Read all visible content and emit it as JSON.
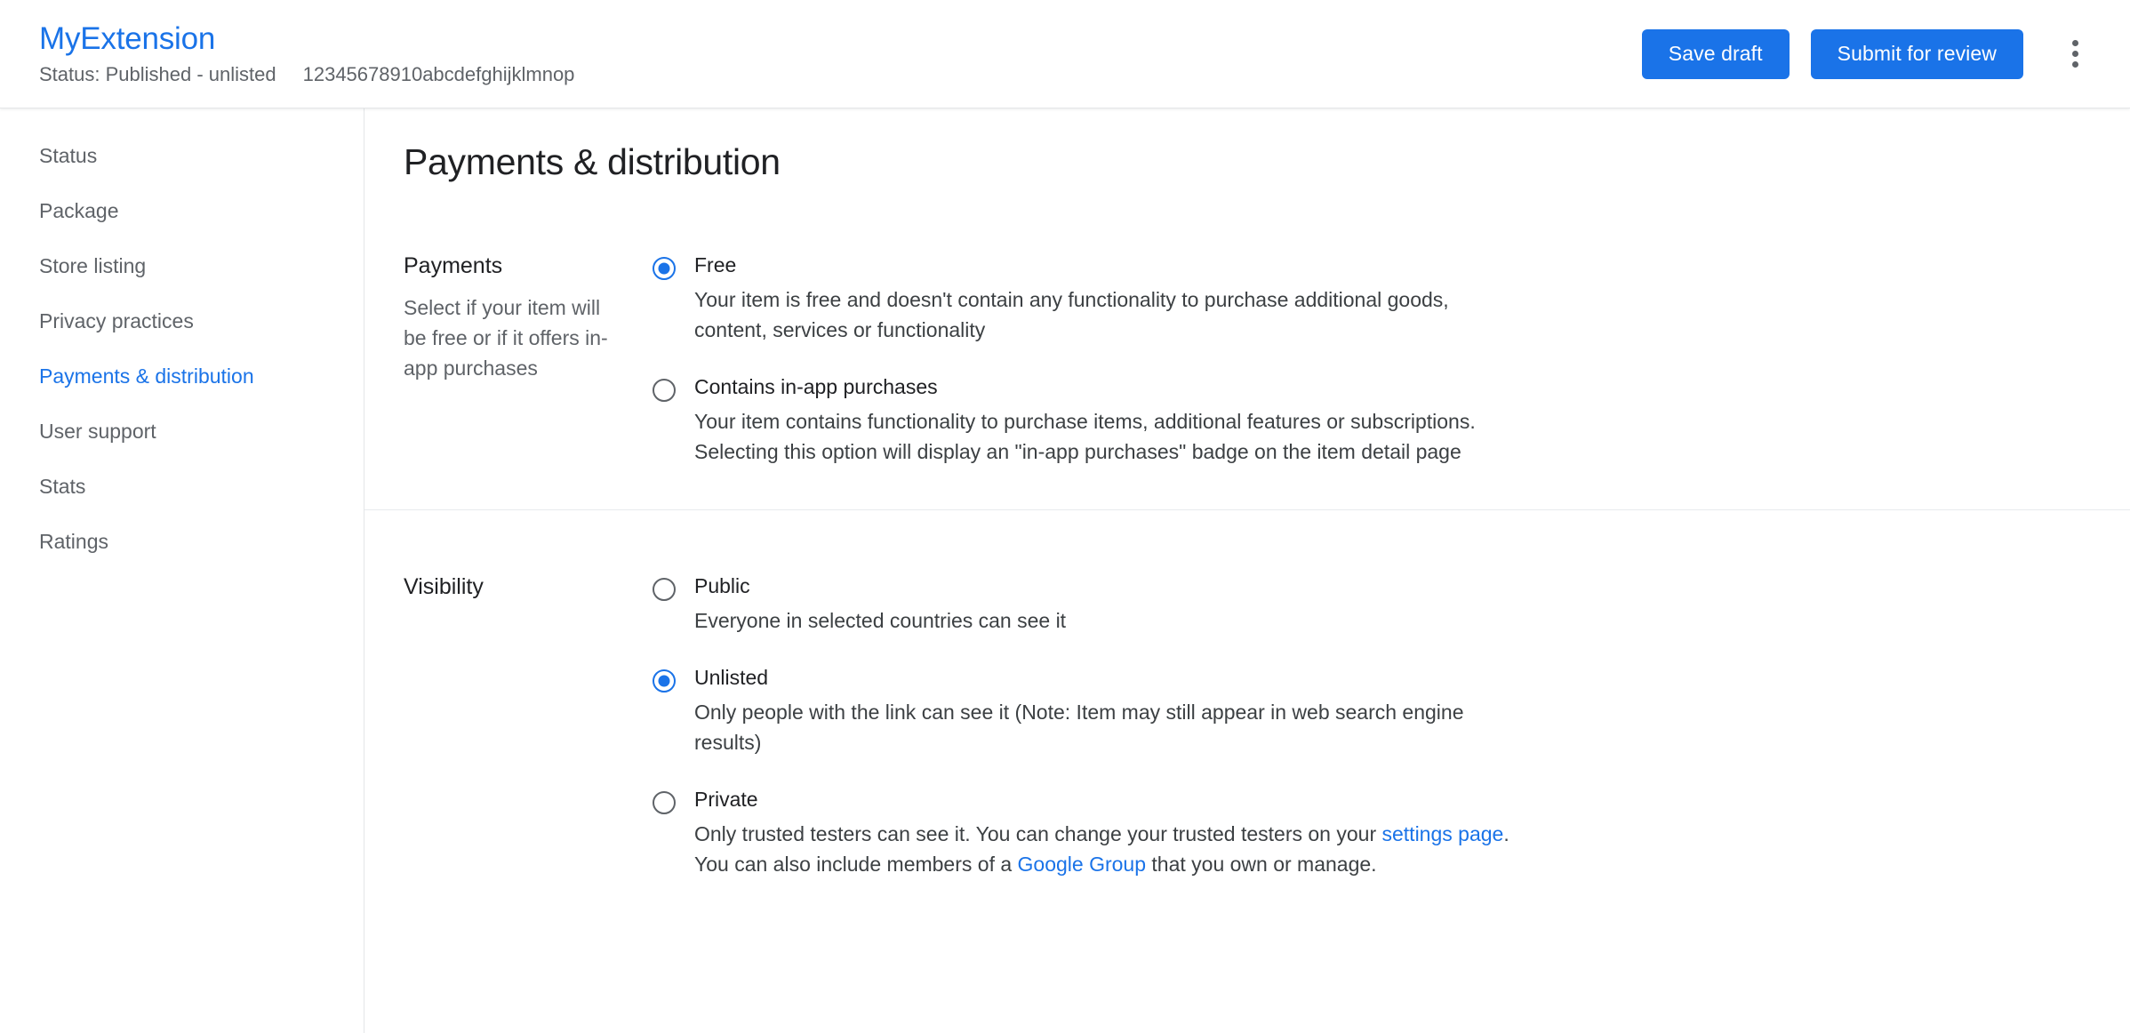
{
  "header": {
    "app_title": "MyExtension",
    "status": "Status: Published - unlisted",
    "item_id": "12345678910abcdefghijklmnop",
    "save_draft_label": "Save draft",
    "submit_label": "Submit for review",
    "overflow_icon": "more-vert-icon"
  },
  "sidebar": {
    "items": [
      {
        "label": "Status",
        "active": false
      },
      {
        "label": "Package",
        "active": false
      },
      {
        "label": "Store listing",
        "active": false
      },
      {
        "label": "Privacy practices",
        "active": false
      },
      {
        "label": "Payments & distribution",
        "active": true
      },
      {
        "label": "User support",
        "active": false
      },
      {
        "label": "Stats",
        "active": false
      },
      {
        "label": "Ratings",
        "active": false
      }
    ]
  },
  "main": {
    "page_title": "Payments & distribution",
    "payments": {
      "label": "Payments",
      "help": "Select if your item will be free or if it offers in-app purchases",
      "options": [
        {
          "label": "Free",
          "desc": "Your item is free and doesn't contain any functionality to purchase additional goods, content, services or functionality",
          "selected": true
        },
        {
          "label": "Contains in-app purchases",
          "desc": "Your item contains functionality to purchase items, additional features or subscriptions. Selecting this option will display an \"in-app purchases\" badge on the item detail page",
          "selected": false
        }
      ]
    },
    "visibility": {
      "label": "Visibility",
      "options": [
        {
          "label": "Public",
          "desc": "Everyone in selected countries can see it",
          "selected": false
        },
        {
          "label": "Unlisted",
          "desc": "Only people with the link can see it (Note: Item may still appear in web search engine results)",
          "selected": true
        },
        {
          "label": "Private",
          "desc_part1": "Only trusted testers can see it. You can change your trusted testers on your ",
          "link1": "settings page",
          "desc_part2": ".",
          "desc_part3": "You can also include members of a ",
          "link2": "Google Group",
          "desc_part4": " that you own or manage.",
          "selected": false
        }
      ]
    }
  },
  "colors": {
    "accent": "#1a73e8",
    "text_primary": "#202124",
    "text_secondary": "#5f6368",
    "border": "#e4e6e8"
  }
}
